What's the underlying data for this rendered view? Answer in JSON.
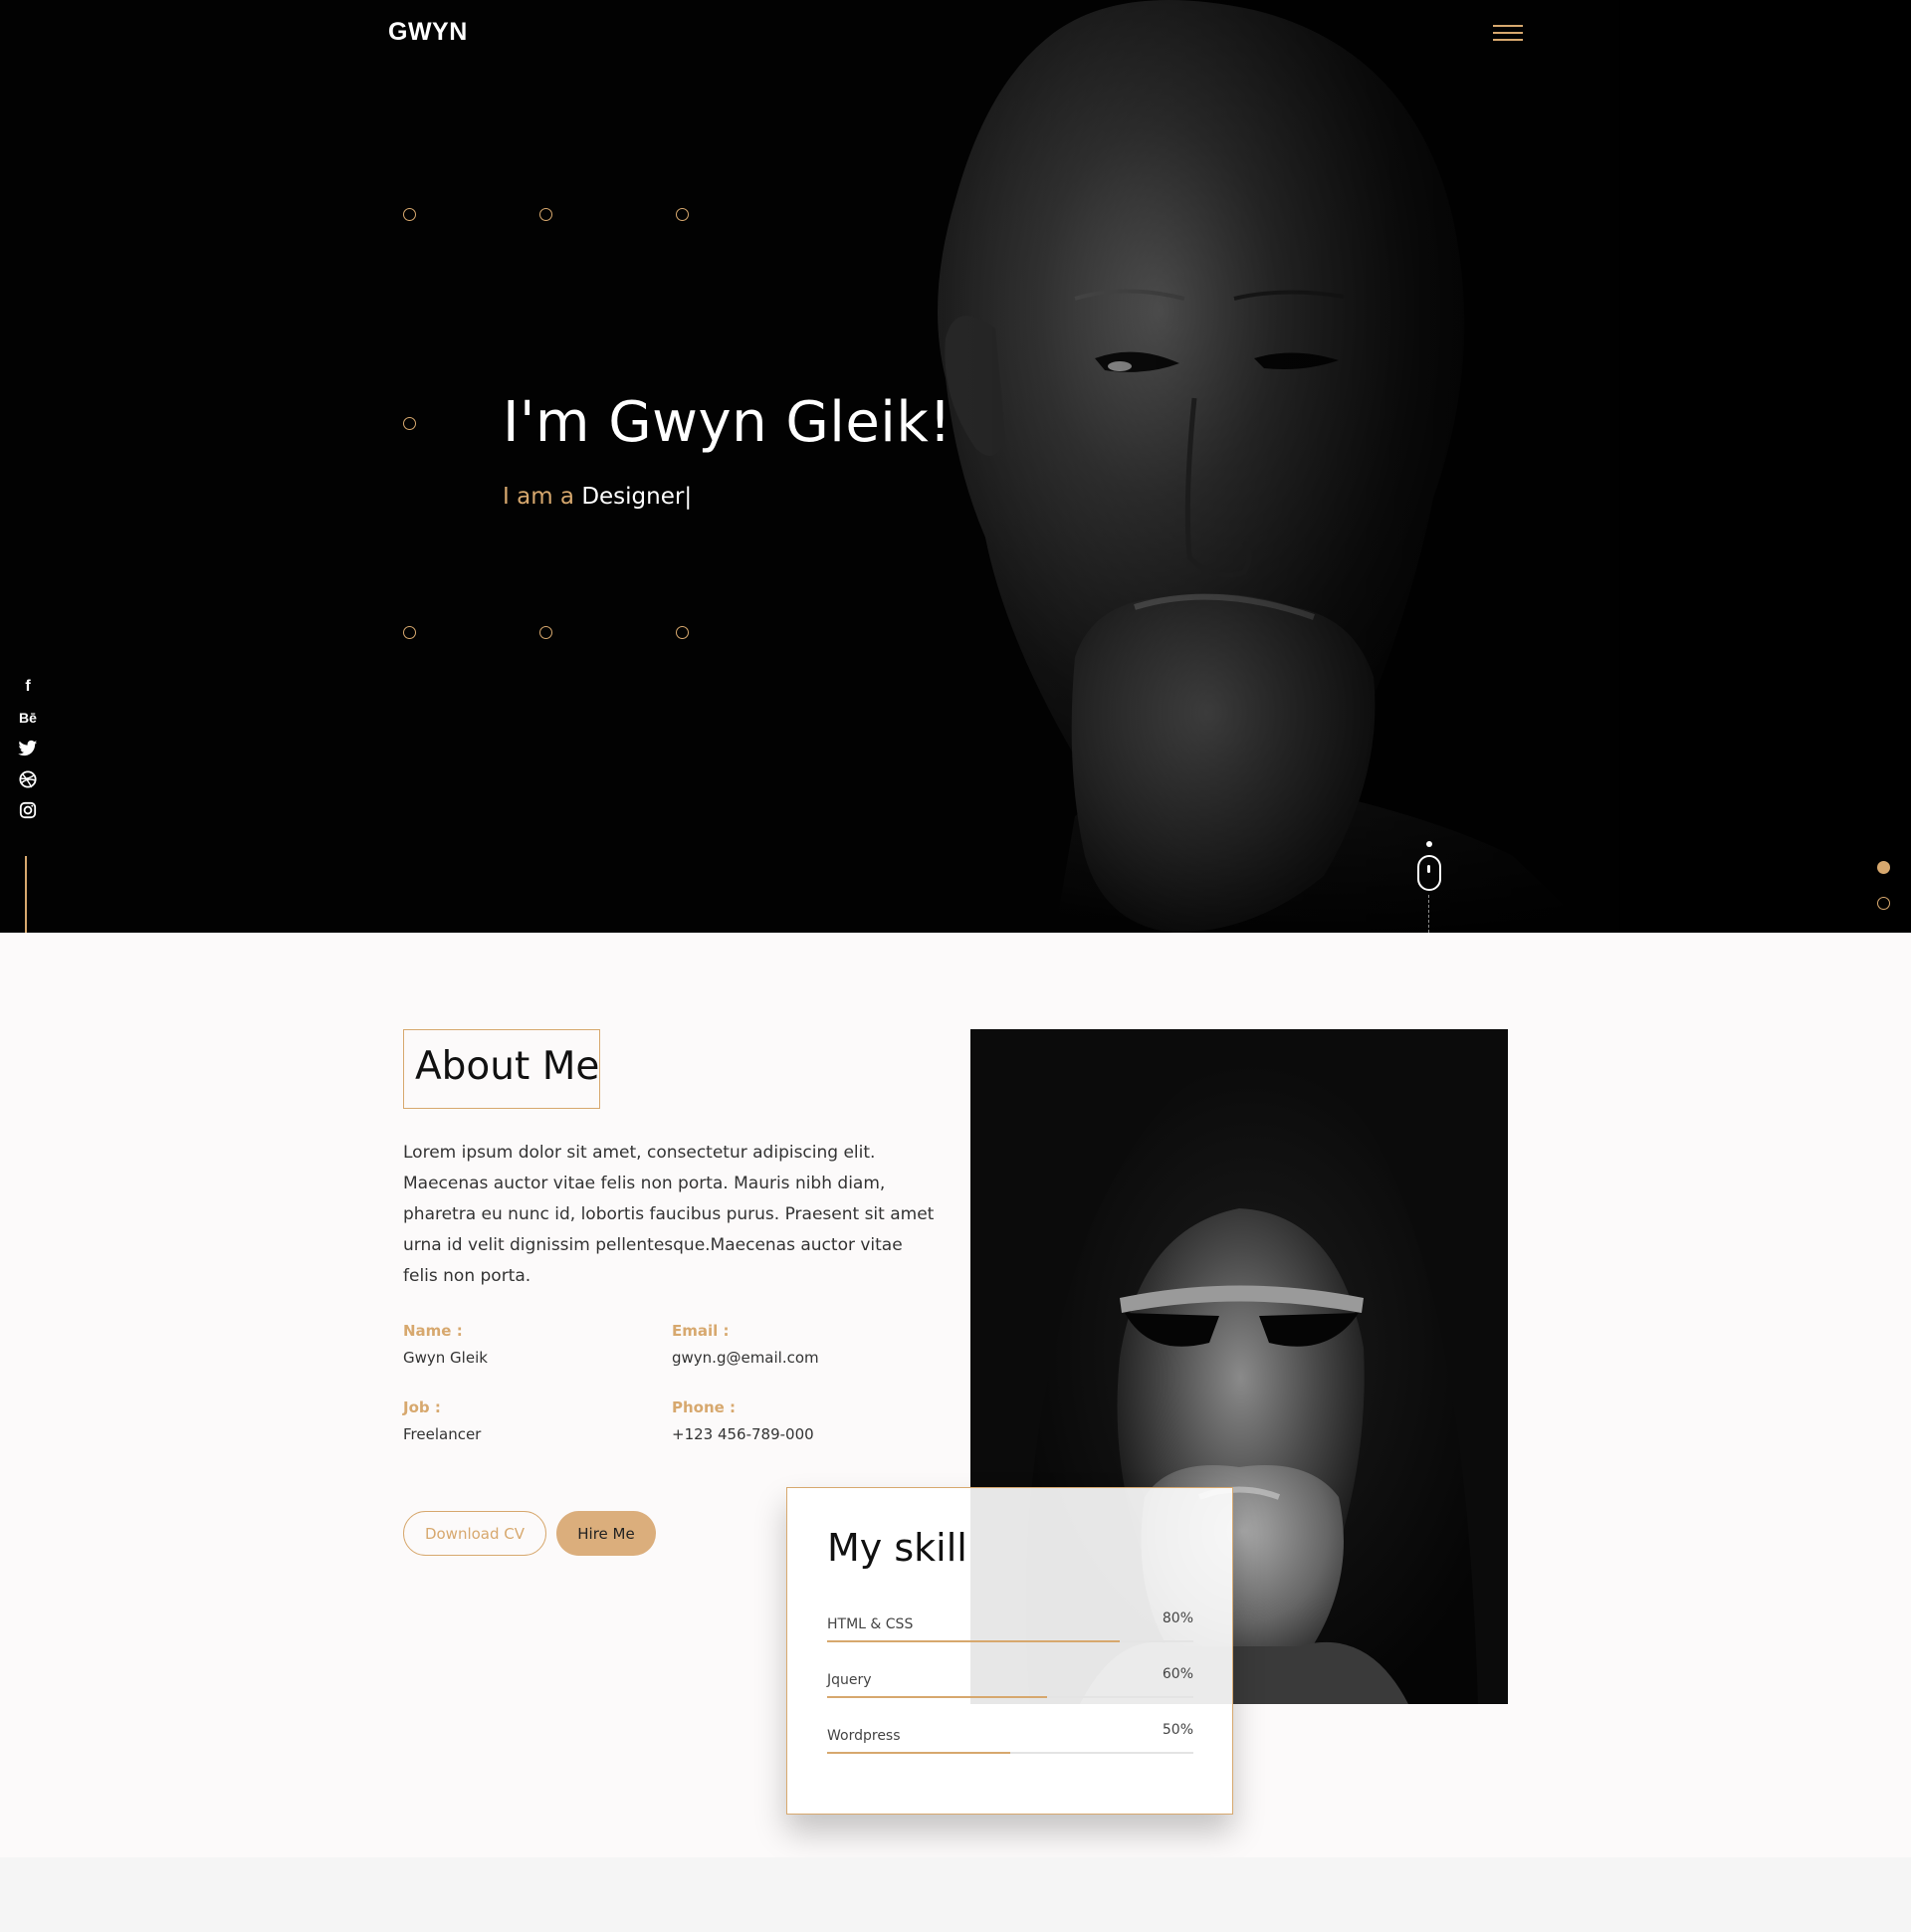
{
  "brand": {
    "logo": "GWYN",
    "accent": "#d7a86e"
  },
  "nav": {
    "menu_icon": "hamburger-icon"
  },
  "hero": {
    "title": "I'm Gwyn Gleik!",
    "subtitle_prefix": "I am a",
    "subtitle_role": "Designer",
    "caret": "|"
  },
  "social": [
    {
      "name": "facebook-icon",
      "glyph": "f"
    },
    {
      "name": "behance-icon",
      "glyph": "Bē"
    },
    {
      "name": "twitter-icon",
      "glyph": ""
    },
    {
      "name": "dribbble-icon",
      "glyph": ""
    },
    {
      "name": "instagram-icon",
      "glyph": ""
    }
  ],
  "pagination": {
    "pages": 2,
    "active": 1
  },
  "about": {
    "title": "About Me",
    "text": "Lorem ipsum dolor sit amet, consectetur adipiscing elit. Maecenas auctor vitae felis non porta. Mauris nibh diam, pharetra eu nunc id, lobortis faucibus purus. Praesent sit amet urna id velit dignissim pellentesque.Maecenas auctor vitae felis non porta.",
    "name_label": "Name :",
    "name_value": "Gwyn Gleik",
    "email_label": "Email :",
    "email_value": "gwyn.g@email.com",
    "job_label": "Job :",
    "job_value": "Freelancer",
    "phone_label": "Phone :",
    "phone_value": "+123 456-789-000",
    "download_label": "Download CV",
    "hire_label": "Hire Me"
  },
  "skills": {
    "title": "My skill",
    "items": [
      {
        "name": "HTML & CSS",
        "percent_label": "80%",
        "percent": 80
      },
      {
        "name": "Jquery",
        "percent_label": "60%",
        "percent": 60
      },
      {
        "name": "Wordpress",
        "percent_label": "50%",
        "percent": 50
      }
    ]
  }
}
